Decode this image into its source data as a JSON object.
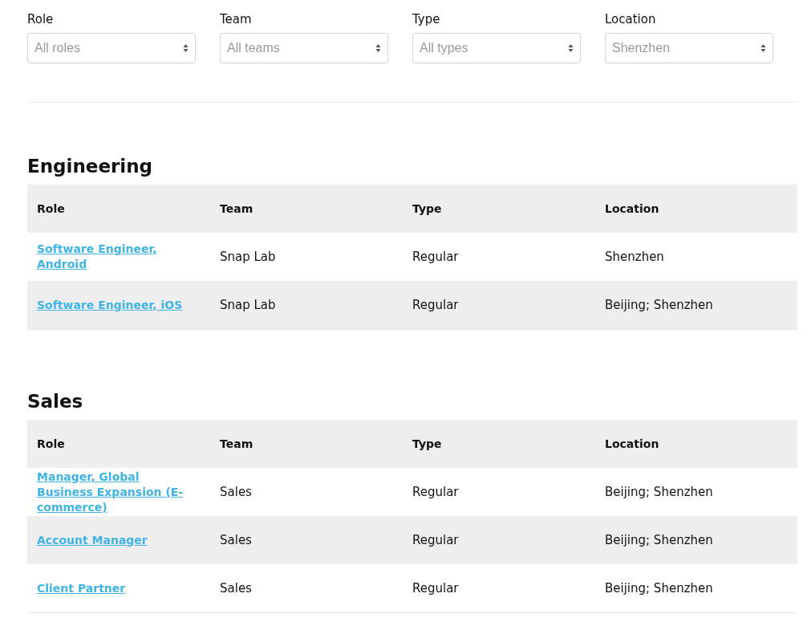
{
  "filters": [
    {
      "label": "Role",
      "value": "All roles"
    },
    {
      "label": "Team",
      "value": "All teams"
    },
    {
      "label": "Type",
      "value": "All types"
    },
    {
      "label": "Location",
      "value": "Shenzhen"
    }
  ],
  "sections": [
    {
      "title": "Engineering",
      "columns": [
        "Role",
        "Team",
        "Type",
        "Location"
      ],
      "rows": [
        {
          "role": "Software Engineer, Android",
          "team": "Snap Lab",
          "type": "Regular",
          "location": "Shenzhen"
        },
        {
          "role": "Software Engineer, iOS",
          "team": "Snap Lab",
          "type": "Regular",
          "location": "Beijing; Shenzhen"
        }
      ]
    },
    {
      "title": "Sales",
      "columns": [
        "Role",
        "Team",
        "Type",
        "Location"
      ],
      "rows": [
        {
          "role": "Manager, Global Business Expansion (E-commerce)",
          "team": "Sales",
          "type": "Regular",
          "location": "Beijing; Shenzhen"
        },
        {
          "role": "Account Manager",
          "team": "Sales",
          "type": "Regular",
          "location": "Beijing; Shenzhen"
        },
        {
          "role": "Client Partner",
          "team": "Sales",
          "type": "Regular",
          "location": "Beijing; Shenzhen"
        }
      ]
    }
  ]
}
